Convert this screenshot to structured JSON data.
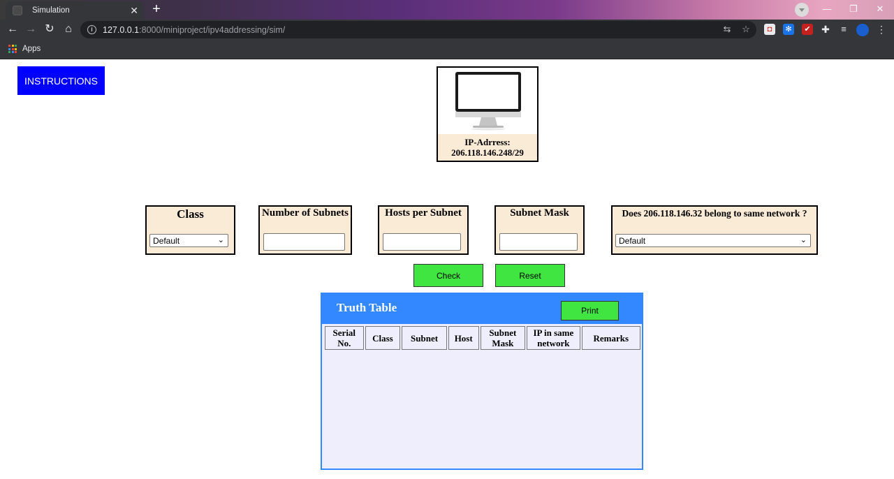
{
  "browser": {
    "tab_title": "Simulation",
    "url_host": "127.0.0.1",
    "url_rest": ":8000/miniproject/ipv4addressing/sim/",
    "bookmarks": {
      "apps_label": "Apps"
    }
  },
  "page": {
    "instructions_label": "INSTRUCTIONS",
    "computer": {
      "ip_label": "IP-Adrress:",
      "ip_value": "206.118.146.248/29"
    },
    "fields": {
      "class_title": "Class",
      "class_selected": "Default",
      "subnets_title": "Number of Subnets",
      "subnets_value": "",
      "hosts_title": "Hosts per Subnet",
      "hosts_value": "",
      "mask_title": "Subnet Mask",
      "mask_value": "",
      "network_question": "Does 206.118.146.32 belong to same network ?",
      "network_selected": "Default"
    },
    "buttons": {
      "check": "Check",
      "reset": "Reset",
      "print": "Print"
    },
    "truth_table": {
      "title": "Truth Table",
      "headers": [
        "Serial No.",
        "Class",
        "Subnet",
        "Host",
        "Subnet Mask",
        "IP in same network",
        "Remarks"
      ],
      "rows": []
    }
  }
}
